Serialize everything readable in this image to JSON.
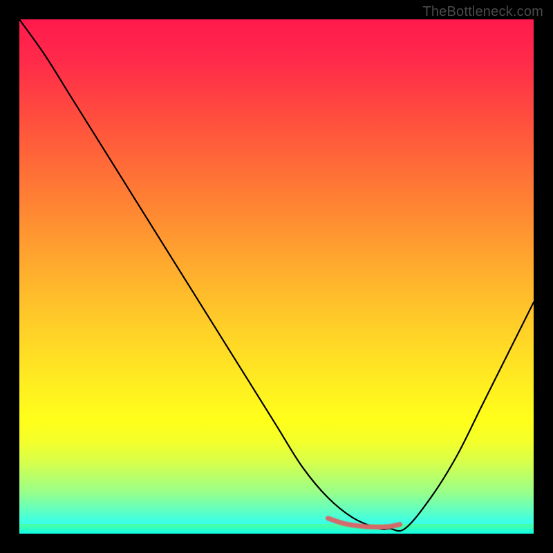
{
  "watermark": "TheBottleneck.com",
  "colors": {
    "background": "#000000",
    "curve": "#000000",
    "accent": "#d46a6a"
  },
  "chart_data": {
    "type": "line",
    "title": "",
    "xlabel": "",
    "ylabel": "",
    "xlim": [
      0,
      100
    ],
    "ylim": [
      0,
      100
    ],
    "grid": false,
    "legend": false,
    "series": [
      {
        "name": "bottleneck-curve",
        "x": [
          0,
          5,
          10,
          15,
          20,
          25,
          30,
          35,
          40,
          45,
          50,
          55,
          60,
          65,
          70,
          72,
          75,
          80,
          85,
          90,
          95,
          100
        ],
        "values": [
          100,
          93,
          85,
          77,
          69,
          61,
          53,
          45,
          37,
          29,
          21,
          13,
          7,
          3,
          1,
          1,
          1,
          7,
          15,
          25,
          35,
          45
        ]
      },
      {
        "name": "accent-segment",
        "x": [
          60,
          63,
          66,
          69,
          72,
          74
        ],
        "values": [
          3,
          2,
          1.5,
          1.3,
          1.4,
          1.8
        ]
      }
    ]
  }
}
